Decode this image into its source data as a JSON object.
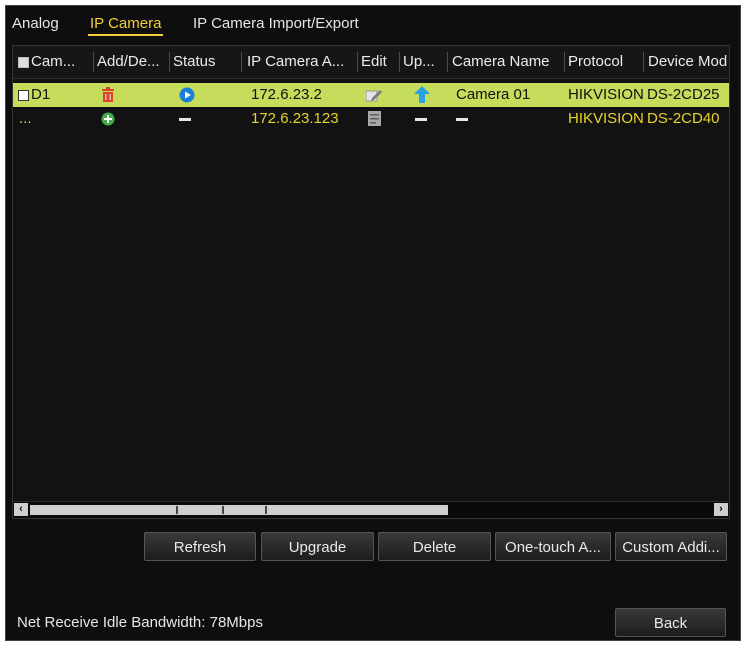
{
  "tabs": [
    {
      "label": "Analog",
      "active": false
    },
    {
      "label": "IP Camera",
      "active": true
    },
    {
      "label": "IP Camera Import/Export",
      "active": false
    }
  ],
  "table": {
    "columns": [
      "Cam...",
      "Add/De...",
      "Status",
      "IP Camera A...",
      "Edit",
      "Up...",
      "Camera Name",
      "Protocol",
      "Device Mod"
    ],
    "rows": [
      {
        "camera": "D1",
        "add_delete_icon": "delete-icon",
        "status_icon": "play-status-icon",
        "ip": "172.6.23.2",
        "edit_icon": "edit-pencil-icon",
        "upgrade_icon": "upgrade-arrow-icon",
        "camera_name": "Camera 01",
        "protocol": "HIKVISION",
        "device_model": "DS-2CD25",
        "selected": true
      },
      {
        "camera": "...",
        "add_delete_icon": "add-icon",
        "status_icon": "dash",
        "ip": "172.6.23.123",
        "edit_icon": "edit-disabled-icon",
        "upgrade_icon": "dash",
        "camera_name": "-",
        "protocol": "HIKVISION",
        "device_model": "DS-2CD40",
        "selected": false
      }
    ]
  },
  "buttons": {
    "refresh": "Refresh",
    "upgrade": "Upgrade",
    "delete": "Delete",
    "one_touch": "One-touch A...",
    "custom_add": "Custom Addi..."
  },
  "status": {
    "bandwidth": "Net Receive Idle Bandwidth: 78Mbps"
  },
  "back_label": "Back",
  "colors": {
    "accent": "#f2cf3a",
    "selected_row": "#c5dd5a",
    "alt_row_text": "#e8d32c",
    "background": "#0e0e0e"
  }
}
